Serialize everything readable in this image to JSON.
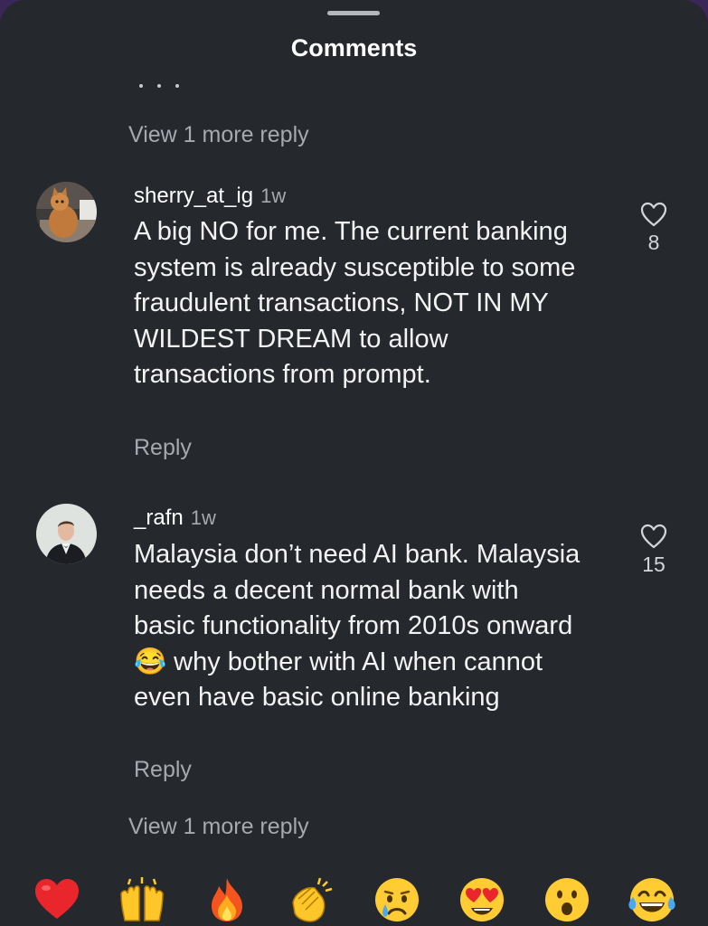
{
  "header": {
    "title": "Comments"
  },
  "thread": {
    "view_more_top": "View 1 more reply",
    "view_more_bottom": "View 1 more reply"
  },
  "comments": [
    {
      "username": "sherry_at_ig",
      "time": "1w",
      "text": "A big NO for me. The current banking system is already susceptible to some fraudulent transactions, NOT IN MY WILDEST DREAM to allow transactions from prompt.",
      "reply_label": "Reply",
      "likes": "8",
      "avatar_icon": "cat-avatar"
    },
    {
      "username": "_rafn",
      "time": "1w",
      "text_before_emoji": "Malaysia don’t need AI bank. Malaysia needs a decent normal bank with basic functionality from 2010s onward",
      "emoji": "😂",
      "text_after_emoji": "why bother with AI when cannot even have basic online banking",
      "reply_label": "Reply",
      "likes": "15",
      "avatar_icon": "man-in-suit-avatar"
    }
  ],
  "emoji_bar": [
    {
      "name": "red-heart-emoji",
      "glyph": "❤️"
    },
    {
      "name": "raising-hands-emoji",
      "glyph": "🙌"
    },
    {
      "name": "fire-emoji",
      "glyph": "🔥"
    },
    {
      "name": "clapping-hands-emoji",
      "glyph": "👏"
    },
    {
      "name": "crying-face-emoji",
      "glyph": "😢"
    },
    {
      "name": "heart-eyes-emoji",
      "glyph": "😍"
    },
    {
      "name": "surprised-face-emoji",
      "glyph": "😮"
    },
    {
      "name": "tears-of-joy-emoji",
      "glyph": "😂"
    }
  ],
  "colors": {
    "background": "#25282d",
    "outer": "#3a2758",
    "muted_text": "#a6a9ae"
  }
}
